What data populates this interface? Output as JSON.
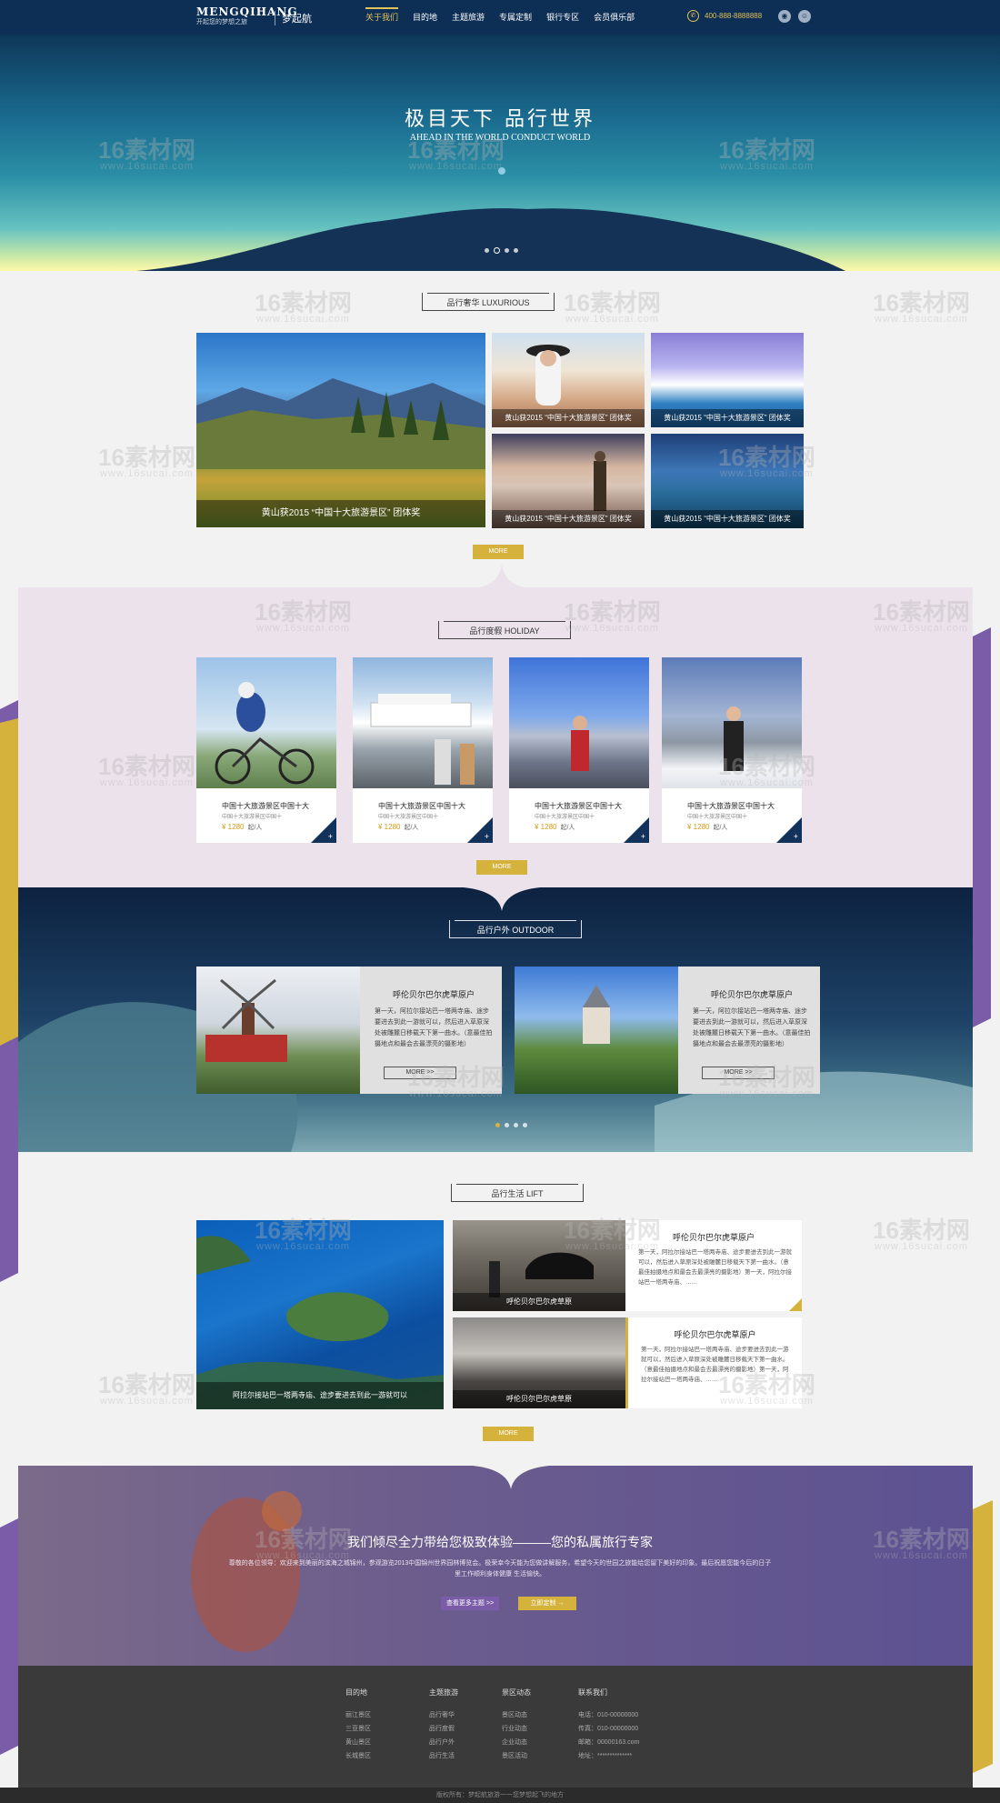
{
  "header": {
    "logo_text": "MENGQIHANG",
    "logo_tagline": "开起您的梦想之旅",
    "brand_name": "梦起航",
    "nav": [
      "关于我们",
      "目的地",
      "主题旅游",
      "专属定制",
      "银行专区",
      "会员俱乐部"
    ],
    "active_nav": "关于我们",
    "phone": "400-888-8888888"
  },
  "banner": {
    "title": "极目天下  品行世界",
    "subtitle": "AHEAD IN THE WORLD CONDUCT WORLD"
  },
  "watermark": {
    "main": "16素材网",
    "sub": "www.16sucai.com"
  },
  "luxurious": {
    "title": "品行奢华  LUXURIOUS",
    "caption": "黄山获2015 “中国十大旅游景区” 团体奖",
    "more": "MORE"
  },
  "holiday": {
    "title": "品行度假  HOLIDAY",
    "card_name": "中国十大旅游景区中国十大",
    "card_sub": "中国十大旅游景区中国十",
    "price": "¥ 1280",
    "price_unit": "起/人",
    "more": "MORE"
  },
  "outdoor": {
    "title": "品行户外  OUTDOOR",
    "card_title": "呼伦贝尔巴尔虎草原户",
    "card_desc": "第一天，阿拉尔接站巴一塔两寺庙、途步要进去到此一游就可以，然后进入草原深处被雕麓日移载天下第一曲水。（意最佳拍摄地点和最会去最漂亮的摄影地）",
    "more": "MORE >>"
  },
  "life": {
    "title": "品行生活  LIFT",
    "big_caption": "阿拉尔接站巴一塔两寺庙、途步要进去到此一游就可以",
    "img_caption": "呼伦贝尔巴尔虎草原",
    "text_title": "呼伦贝尔巴尔虎草原户",
    "text_desc": "第一天，阿拉尔接站巴一塔两寺庙、途步要进去到此一游就可以，然后进入草原深处被雕麓日移载天下第一曲水。（意最佳拍摄地点和最会去最漂亮的摄影地）第一天，阿拉尔接站巴一塔两寺庙、……",
    "more": "MORE"
  },
  "promo": {
    "title": "我们倾尽全力带给您极致体验———您的私属旅行专家",
    "text": "尊敬的各位领导：欢迎来到美丽的滨海之城锦州，参观游览2013中国锦州世界园林博览会。极荣幸今天能为您做讲解服务，希望今天的世园之旅能给您留下美好的印象。最后祝愿您能今后的日子里工作顺利身体健康 生活愉快。",
    "btn1": "查看更多主题 >>",
    "btn2": "立即定制 →"
  },
  "footer": {
    "columns": [
      {
        "heading": "目的地",
        "items": [
          "丽江景区",
          "三亚景区",
          "黄山景区",
          "长城景区"
        ]
      },
      {
        "heading": "主题旅游",
        "items": [
          "品行奢华",
          "品行度假",
          "品行户外",
          "品行生活"
        ]
      },
      {
        "heading": "景区动态",
        "items": [
          "景区动态",
          "行业动态",
          "企业动态",
          "景区活动"
        ]
      },
      {
        "heading": "联系我们",
        "items": [
          "电话：010-00000000",
          "传真：010-00000000",
          "邮箱：00000163.com",
          "地址：**************"
        ]
      }
    ],
    "copyright": "版权所有：梦起航旅游一一您梦想起飞的地方"
  },
  "colors": {
    "navy": "#0d2e55",
    "gold": "#d4b23b",
    "purple": "#7a5ca8"
  }
}
